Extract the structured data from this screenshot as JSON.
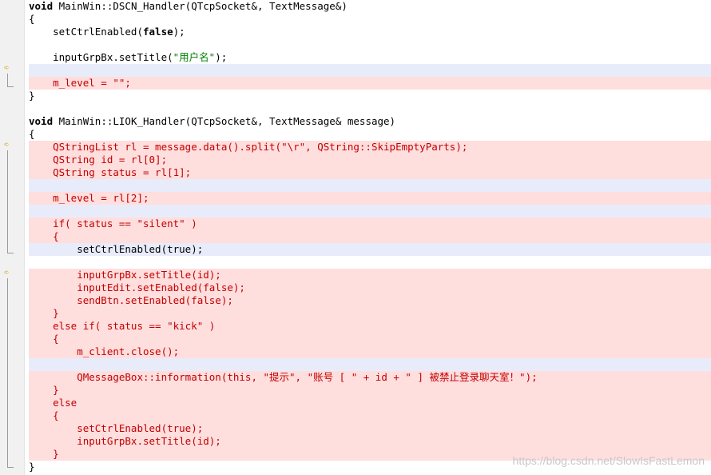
{
  "gutter": {
    "markers": [
      "arrow-icon",
      "arrow-icon",
      "arrow-icon"
    ]
  },
  "code": {
    "lines": [
      {
        "pre": "",
        "kw": "void",
        "post": " MainWin::DSCN_Handler(QTcpSocket&, TextMessage&)",
        "style": "normal"
      },
      {
        "pre": "{",
        "kw": "",
        "post": "",
        "style": "normal"
      },
      {
        "pre": "    setCtrlEnabled(",
        "kw": "false",
        "post": ");",
        "style": "normal"
      },
      {
        "pre": "",
        "kw": "",
        "post": "",
        "style": "normal"
      },
      {
        "pre": "    inputGrpBx.setTitle(",
        "kw": "",
        "post": "",
        "str": "\"用户名\"",
        "after": ");",
        "style": "normal"
      },
      {
        "pre": "",
        "kw": "",
        "post": "",
        "style": "blank-ins"
      },
      {
        "pre": "    m_level = \"\";",
        "kw": "",
        "post": "",
        "style": "del"
      },
      {
        "pre": "}",
        "kw": "",
        "post": "",
        "style": "normal"
      },
      {
        "pre": "",
        "kw": "",
        "post": "",
        "style": "normal"
      },
      {
        "pre": "",
        "kw": "void",
        "post": " MainWin::LIOK_Handler(QTcpSocket&, TextMessage& message)",
        "style": "normal"
      },
      {
        "pre": "{",
        "kw": "",
        "post": "",
        "style": "normal"
      },
      {
        "pre": "    QStringList rl = message.data().split(\"\\r\", QString::SkipEmptyParts);",
        "kw": "",
        "post": "",
        "style": "del"
      },
      {
        "pre": "    QString id = rl[0];",
        "kw": "",
        "post": "",
        "style": "del"
      },
      {
        "pre": "    QString status = rl[1];",
        "kw": "",
        "post": "",
        "style": "del"
      },
      {
        "pre": "",
        "kw": "",
        "post": "",
        "style": "blank-ins"
      },
      {
        "pre": "    m_level = rl[2];",
        "kw": "",
        "post": "",
        "style": "del"
      },
      {
        "pre": "",
        "kw": "",
        "post": "",
        "style": "blank-ins"
      },
      {
        "pre": "    if( status == \"silent\" )",
        "kw": "",
        "post": "",
        "style": "del"
      },
      {
        "pre": "    {",
        "kw": "",
        "post": "",
        "style": "del"
      },
      {
        "pre": "        setCtrlEnabled(true);",
        "kw": "",
        "post": "",
        "style": "ins"
      },
      {
        "pre": "",
        "kw": "",
        "post": "",
        "style": "normal"
      },
      {
        "pre": "        inputGrpBx.setTitle(id);",
        "kw": "",
        "post": "",
        "style": "ins-del"
      },
      {
        "pre": "        inputEdit.setEnabled(false);",
        "kw": "",
        "post": "",
        "style": "del"
      },
      {
        "pre": "        sendBtn.setEnabled(false);",
        "kw": "",
        "post": "",
        "style": "del"
      },
      {
        "pre": "    }",
        "kw": "",
        "post": "",
        "style": "del"
      },
      {
        "pre": "    else if( status == \"kick\" )",
        "kw": "",
        "post": "",
        "style": "del"
      },
      {
        "pre": "    {",
        "kw": "",
        "post": "",
        "style": "del"
      },
      {
        "pre": "        m_client.close();",
        "kw": "",
        "post": "",
        "style": "del"
      },
      {
        "pre": "",
        "kw": "",
        "post": "",
        "style": "blank-ins"
      },
      {
        "pre": "        QMessageBox::information(this, \"提示\", \"账号 [ \" + id + \" ] 被禁止登录聊天室！\");",
        "kw": "",
        "post": "",
        "style": "del"
      },
      {
        "pre": "    }",
        "kw": "",
        "post": "",
        "style": "del"
      },
      {
        "pre": "    else",
        "kw": "",
        "post": "",
        "style": "del"
      },
      {
        "pre": "    {",
        "kw": "",
        "post": "",
        "style": "del"
      },
      {
        "pre": "        setCtrlEnabled(true);",
        "kw": "",
        "post": "",
        "style": "del"
      },
      {
        "pre": "        inputGrpBx.setTitle(id);",
        "kw": "",
        "post": "",
        "style": "del"
      },
      {
        "pre": "    }",
        "kw": "",
        "post": "",
        "style": "del"
      },
      {
        "pre": "}",
        "kw": "",
        "post": "",
        "style": "normal"
      }
    ]
  },
  "watermark": "https://blog.csdn.net/SlowIsFastLemon"
}
